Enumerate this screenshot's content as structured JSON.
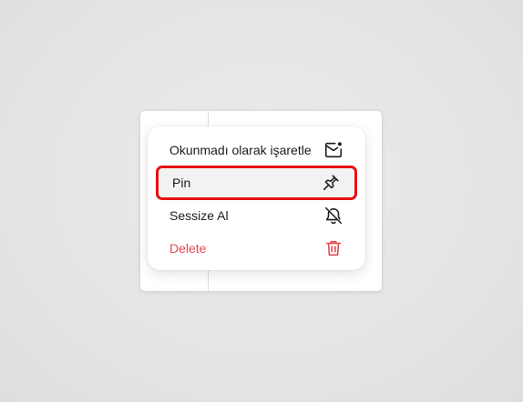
{
  "menu": {
    "items": [
      {
        "label": "Okunmadı olarak işaretle",
        "icon": "mail-unread-icon"
      },
      {
        "label": "Pin",
        "icon": "pin-icon"
      },
      {
        "label": "Sessize Al",
        "icon": "bell-off-icon"
      },
      {
        "label": "Delete",
        "icon": "trash-icon"
      }
    ]
  },
  "colors": {
    "danger": "#e5484d",
    "highlight_border": "#e8100f"
  }
}
